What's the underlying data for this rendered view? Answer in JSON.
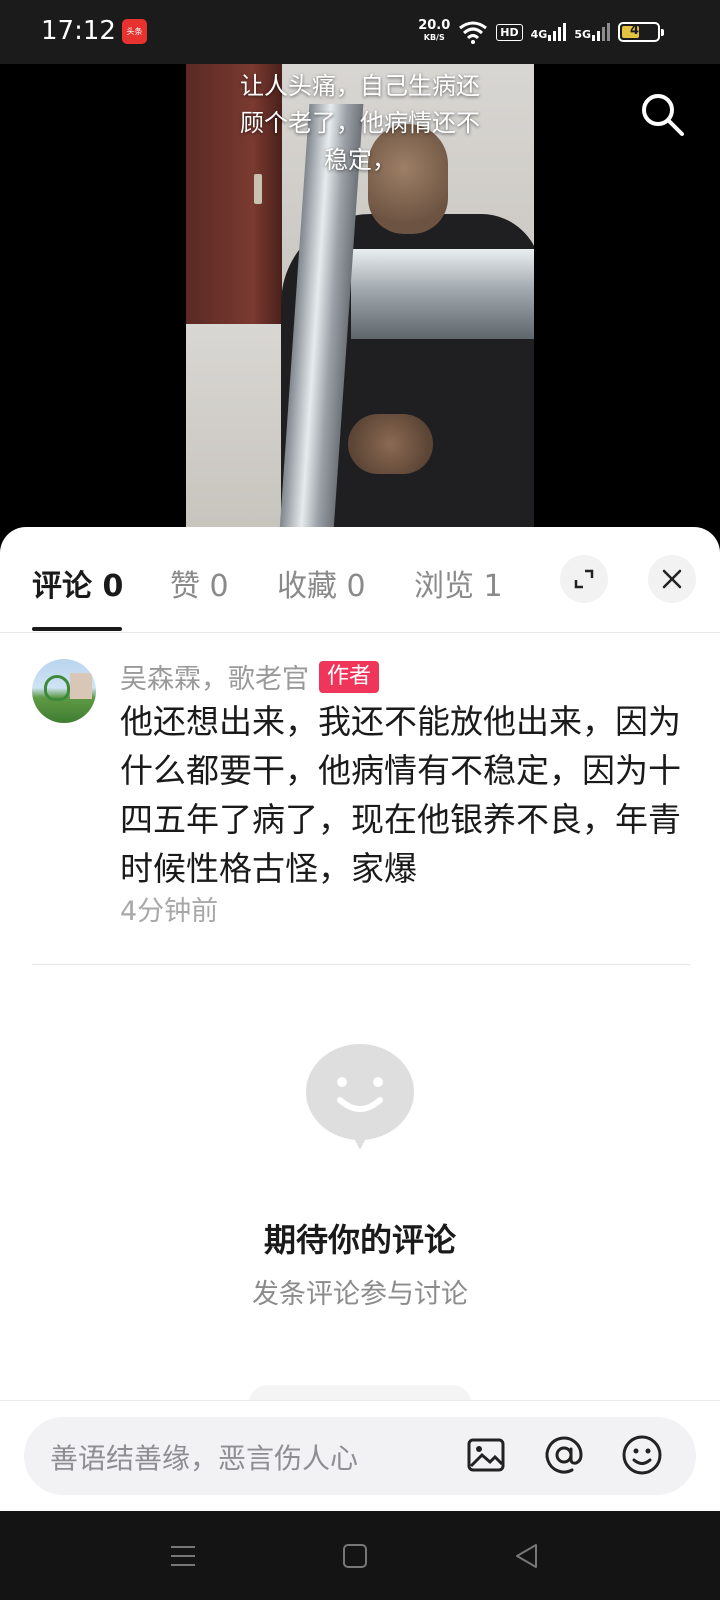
{
  "status_bar": {
    "time": "17:12",
    "app_icon_text": "头条",
    "net_speed": "20.0",
    "net_speed_unit": "KB/S",
    "hd_label": "HD",
    "net1": "4G",
    "net2": "5G",
    "battery": "49",
    "battery_color": "#e4c341"
  },
  "video": {
    "caption_lines": [
      "让人头痛，自己生病还",
      "顾个老了，他病情还不",
      "稳定，"
    ],
    "search_icon": "search-icon"
  },
  "tabs": [
    {
      "label": "评论 0",
      "active": true
    },
    {
      "label": "赞 0",
      "active": false
    },
    {
      "label": "收藏 0",
      "active": false
    },
    {
      "label": "浏览 1",
      "active": false
    }
  ],
  "panel_buttons": {
    "expand_icon": "expand-icon",
    "close_icon": "close-icon"
  },
  "comment": {
    "author": "吴森霖，歌老官",
    "badge": "作者",
    "badge_color": "#f0355b",
    "text": "他还想出来，我还不能放他出来，因为什么都要干，他病情有不稳定，因为十四五年了病了，现在他银养不良，年青时候性格古怪，家爆",
    "time": "4分钟前"
  },
  "empty_state": {
    "icon": "smile-bubble-icon",
    "title": "期待你的评论",
    "subtitle": "发条评论参与讨论"
  },
  "input_bar": {
    "placeholder": "善语结善缘，恶言伤人心",
    "icons": [
      "image-icon",
      "at-icon",
      "emoji-icon"
    ]
  },
  "nav_bar": {
    "icons": [
      "menu-icon",
      "home-icon",
      "back-icon"
    ]
  }
}
